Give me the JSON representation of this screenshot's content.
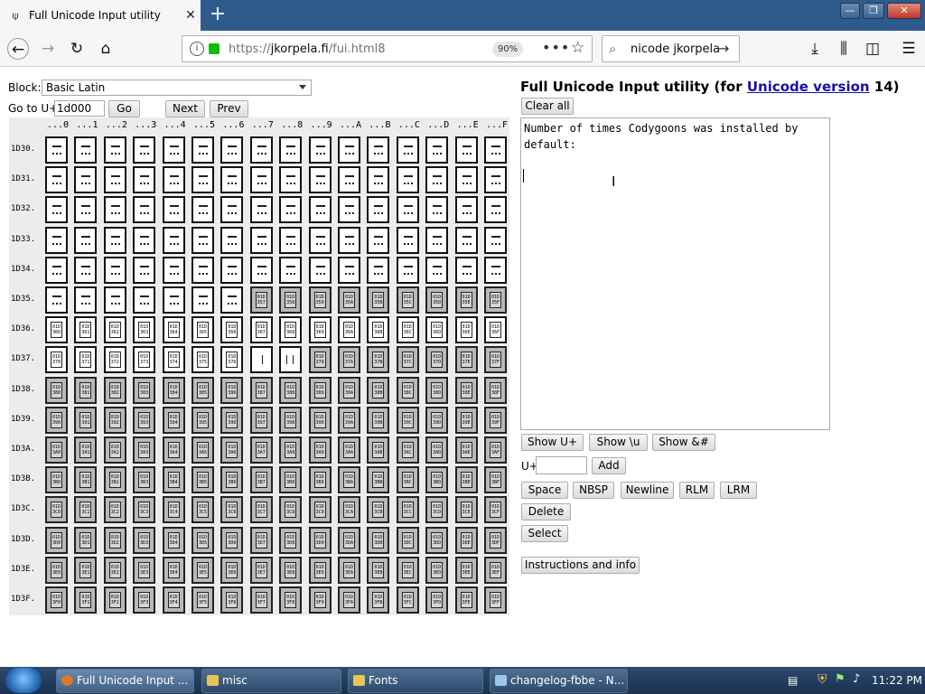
{
  "browser": {
    "tab_title": "Full Unicode Input utility",
    "url_prefix": "https://",
    "url_domain": "jkorpela.fi",
    "url_path": "/fui.html8",
    "zoom": "90%",
    "search_text": "nicode jkorpela"
  },
  "page": {
    "block_label": "Block:",
    "block_value": "Basic Latin",
    "goto_label": "Go to U+",
    "goto_value": "1d000",
    "go_button": "Go",
    "next_button": "Next",
    "prev_button": "Prev",
    "column_headers": [
      "...0",
      "...1",
      "...2",
      "...3",
      "...4",
      "...5",
      "...6",
      "...7",
      "...8",
      "...9",
      "...A",
      "...B",
      "...C",
      "...D",
      "...E",
      "...F"
    ],
    "row_headers": [
      "1D30.",
      "1D31.",
      "1D32.",
      "1D33.",
      "1D34.",
      "1D35.",
      "1D36.",
      "1D37.",
      "1D38.",
      "1D39.",
      "1D3A.",
      "1D3B.",
      "1D3C.",
      "1D3D.",
      "1D3E.",
      "1D3F."
    ],
    "title_prefix": "Full Unicode Input utility (for ",
    "title_link": "Unicode version",
    "title_suffix": " 14)",
    "clear_all": "Clear all",
    "textarea_text": "Number of times Codygoons was installed by\ndefault:",
    "show_uplus": "Show U+",
    "show_backslash_u": "Show \\u",
    "show_entity": "Show &#",
    "uplus_label": "U+",
    "add_button": "Add",
    "space": "Space",
    "nbsp": "NBSP",
    "newline": "Newline",
    "rlm": "RLM",
    "lrm": "LRM",
    "delete": "Delete",
    "select": "Select",
    "instructions": "Instructions and info"
  },
  "taskbar": {
    "items": [
      "Full Unicode Input ...",
      "misc",
      "Fonts",
      "changelog-fbbe - N..."
    ],
    "clock": "11:22 PM"
  }
}
